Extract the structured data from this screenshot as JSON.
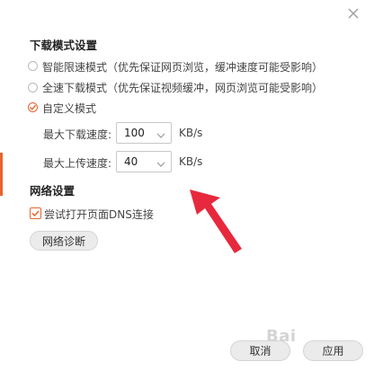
{
  "download_section": {
    "title": "下载模式设置",
    "options": [
      {
        "label": "智能限速模式（优先保证网页浏览，缓冲速度可能受影响）",
        "selected": false
      },
      {
        "label": "全速下载模式（优先保证视频缓冲，网页浏览可能受影响）",
        "selected": false
      },
      {
        "label": "自定义模式",
        "selected": true
      }
    ],
    "max_download_label": "最大下载速度:",
    "max_download_value": "100",
    "max_upload_label": "最大上传速度:",
    "max_upload_value": "40",
    "unit": "KB/s"
  },
  "network_section": {
    "title": "网络设置",
    "dns_checkbox_label": "尝试打开页面DNS连接",
    "dns_checked": true,
    "diagnose_button": "网络诊断"
  },
  "footer": {
    "cancel_label": "取消",
    "apply_label": "应用"
  },
  "watermark_text": "Bai",
  "colors": {
    "accent": "#e8632e",
    "annotation_arrow": "#e8283c"
  }
}
